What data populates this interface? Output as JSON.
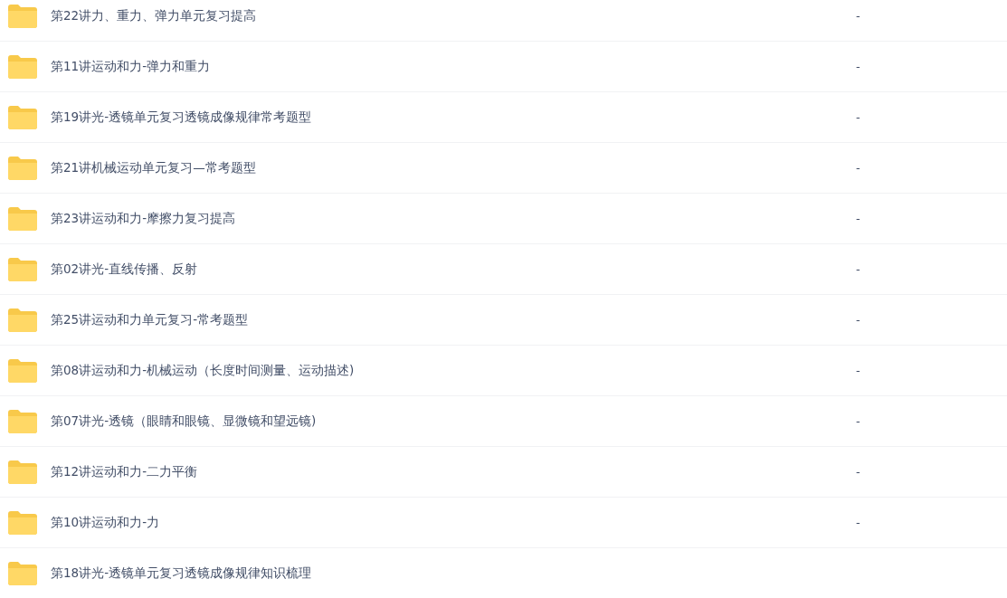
{
  "files": [
    {
      "name": "第22讲力、重力、弹力单元复习提高",
      "size": "-"
    },
    {
      "name": "第11讲运动和力-弹力和重力",
      "size": "-"
    },
    {
      "name": "第19讲光-透镜单元复习透镜成像规律常考题型",
      "size": "-"
    },
    {
      "name": "第21讲机械运动单元复习—常考题型",
      "size": "-"
    },
    {
      "name": "第23讲运动和力-摩擦力复习提高",
      "size": "-"
    },
    {
      "name": "第02讲光-直线传播、反射",
      "size": "-"
    },
    {
      "name": "第25讲运动和力单元复习-常考题型",
      "size": "-"
    },
    {
      "name": "第08讲运动和力-机械运动（长度时间测量、运动描述)",
      "size": "-"
    },
    {
      "name": "第07讲光-透镜（眼睛和眼镜、显微镜和望远镜)",
      "size": "-"
    },
    {
      "name": "第12讲运动和力-二力平衡",
      "size": "-"
    },
    {
      "name": "第10讲运动和力-力",
      "size": "-"
    },
    {
      "name": "第18讲光-透镜单元复习透镜成像规律知识梳理"
    }
  ]
}
